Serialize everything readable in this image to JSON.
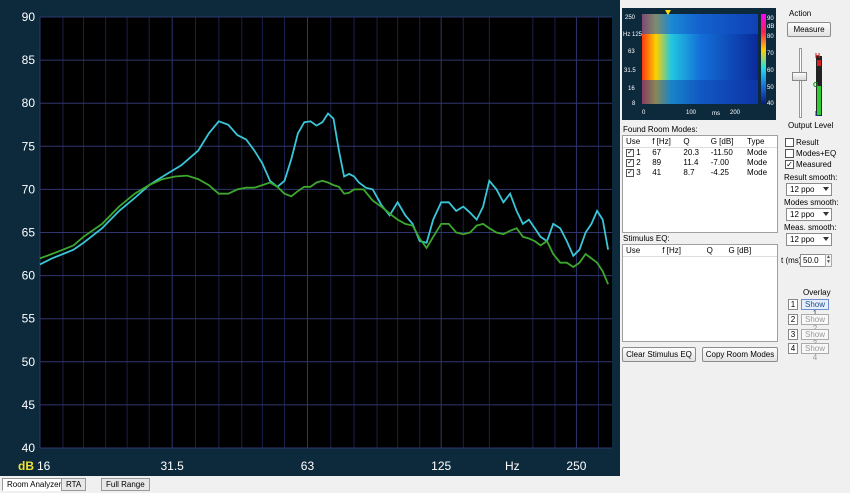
{
  "chart_data": {
    "type": "line",
    "ylabel": "dB",
    "xlabel": "Hz",
    "ylim": [
      40,
      90
    ],
    "xlim_hz": [
      16,
      300
    ],
    "x_scale": "log",
    "grid": true,
    "y_ticks": [
      90,
      85,
      80,
      75,
      70,
      65,
      60,
      55,
      50,
      45,
      40
    ],
    "x_ticks": [
      {
        "label": "16",
        "hz": 16
      },
      {
        "label": "31.5",
        "hz": 31.5
      },
      {
        "label": "63",
        "hz": 63
      },
      {
        "label": "125",
        "hz": 125
      },
      {
        "label": "Hz",
        "hz": 180
      },
      {
        "label": "250",
        "hz": 250
      }
    ],
    "series": [
      {
        "color": "#39c6d8",
        "points": [
          [
            16,
            61.3
          ],
          [
            17,
            62.0
          ],
          [
            18,
            62.5
          ],
          [
            19,
            63.0
          ],
          [
            20,
            63.8
          ],
          [
            22,
            65.5
          ],
          [
            24,
            67.5
          ],
          [
            26,
            69.0
          ],
          [
            28,
            70.5
          ],
          [
            30,
            71.5
          ],
          [
            33,
            72.8
          ],
          [
            36,
            74.5
          ],
          [
            38,
            76.5
          ],
          [
            40,
            77.9
          ],
          [
            42,
            77.5
          ],
          [
            44,
            76.3
          ],
          [
            46,
            75.8
          ],
          [
            48,
            74.5
          ],
          [
            50,
            73.0
          ],
          [
            52,
            71.0
          ],
          [
            54,
            70.3
          ],
          [
            56,
            71.0
          ],
          [
            58,
            73.5
          ],
          [
            60,
            76.5
          ],
          [
            62,
            77.8
          ],
          [
            64,
            77.9
          ],
          [
            66,
            77.4
          ],
          [
            68,
            77.8
          ],
          [
            70,
            78.8
          ],
          [
            72,
            78.2
          ],
          [
            74,
            74.5
          ],
          [
            76,
            71.5
          ],
          [
            78,
            71.8
          ],
          [
            80,
            71.5
          ],
          [
            82,
            70.8
          ],
          [
            85,
            70.2
          ],
          [
            88,
            70.0
          ],
          [
            92,
            68.2
          ],
          [
            96,
            67.0
          ],
          [
            100,
            68.5
          ],
          [
            104,
            67.0
          ],
          [
            108,
            66.0
          ],
          [
            112,
            64.0
          ],
          [
            116,
            63.8
          ],
          [
            120,
            66.5
          ],
          [
            125,
            68.5
          ],
          [
            130,
            68.5
          ],
          [
            135,
            67.5
          ],
          [
            140,
            68.0
          ],
          [
            145,
            67.3
          ],
          [
            150,
            66.5
          ],
          [
            155,
            68.0
          ],
          [
            160,
            71.0
          ],
          [
            166,
            70.0
          ],
          [
            172,
            68.5
          ],
          [
            178,
            69.5
          ],
          [
            184,
            67.5
          ],
          [
            190,
            66.0
          ],
          [
            196,
            66.5
          ],
          [
            202,
            65.5
          ],
          [
            208,
            64.5
          ],
          [
            215,
            64.0
          ],
          [
            222,
            66.0
          ],
          [
            230,
            65.5
          ],
          [
            238,
            64.0
          ],
          [
            246,
            62.3
          ],
          [
            254,
            63.0
          ],
          [
            262,
            65.0
          ],
          [
            270,
            66.0
          ],
          [
            278,
            67.5
          ],
          [
            286,
            66.5
          ],
          [
            294,
            63.0
          ]
        ]
      },
      {
        "color": "#3ca82d",
        "points": [
          [
            16,
            62.0
          ],
          [
            17,
            62.5
          ],
          [
            18,
            63.0
          ],
          [
            19,
            63.5
          ],
          [
            20,
            64.5
          ],
          [
            22,
            66.0
          ],
          [
            24,
            68.0
          ],
          [
            26,
            69.5
          ],
          [
            28,
            70.5
          ],
          [
            30,
            71.2
          ],
          [
            32,
            71.5
          ],
          [
            34,
            71.6
          ],
          [
            36,
            71.2
          ],
          [
            38,
            70.5
          ],
          [
            40,
            69.5
          ],
          [
            42,
            69.5
          ],
          [
            44,
            70.0
          ],
          [
            46,
            70.2
          ],
          [
            48,
            70.2
          ],
          [
            50,
            70.5
          ],
          [
            52,
            70.8
          ],
          [
            54,
            70.3
          ],
          [
            56,
            69.5
          ],
          [
            58,
            69.2
          ],
          [
            60,
            69.8
          ],
          [
            62,
            70.3
          ],
          [
            64,
            70.3
          ],
          [
            66,
            70.8
          ],
          [
            68,
            71.0
          ],
          [
            70,
            70.8
          ],
          [
            72,
            70.5
          ],
          [
            74,
            70.3
          ],
          [
            76,
            69.5
          ],
          [
            78,
            69.6
          ],
          [
            80,
            70.0
          ],
          [
            84,
            70.0
          ],
          [
            88,
            68.7
          ],
          [
            92,
            68.0
          ],
          [
            96,
            67.2
          ],
          [
            100,
            66.5
          ],
          [
            104,
            66.0
          ],
          [
            108,
            65.8
          ],
          [
            112,
            64.3
          ],
          [
            116,
            63.2
          ],
          [
            120,
            64.5
          ],
          [
            125,
            66.0
          ],
          [
            130,
            66.0
          ],
          [
            135,
            65.0
          ],
          [
            140,
            64.8
          ],
          [
            145,
            65.0
          ],
          [
            150,
            65.8
          ],
          [
            155,
            66.0
          ],
          [
            160,
            65.5
          ],
          [
            166,
            65.0
          ],
          [
            172,
            64.8
          ],
          [
            178,
            65.2
          ],
          [
            184,
            65.5
          ],
          [
            190,
            64.5
          ],
          [
            196,
            64.3
          ],
          [
            202,
            64.0
          ],
          [
            208,
            63.5
          ],
          [
            215,
            64.0
          ],
          [
            222,
            62.5
          ],
          [
            230,
            61.5
          ],
          [
            238,
            61.5
          ],
          [
            246,
            61.0
          ],
          [
            254,
            61.5
          ],
          [
            262,
            62.5
          ],
          [
            270,
            62.0
          ],
          [
            278,
            61.5
          ],
          [
            286,
            60.5
          ],
          [
            294,
            59.0
          ]
        ]
      }
    ]
  },
  "right_panel": {
    "waterfall": {
      "y_ticks": [
        "250",
        "Hz 125",
        "63",
        "31.5",
        "16",
        "8"
      ],
      "x_ticks": [
        "0",
        "100",
        "ms",
        "200"
      ],
      "scale_ticks": [
        "90",
        "dB",
        "80",
        "70",
        "60",
        "50",
        "40"
      ]
    },
    "action_label": "Action",
    "measure_button": "Measure",
    "output_level_label": "Output Level",
    "meter_h": "H",
    "meter_g": "G",
    "meter_l": "L",
    "found_modes_label": "Found Room Modes:",
    "modes_headers": [
      "Use",
      "f [Hz]",
      "Q",
      "G [dB]",
      "Type"
    ],
    "modes_rows": [
      {
        "use": "1",
        "f": "67",
        "q": "20.3",
        "g": "-11.50",
        "type": "Mode"
      },
      {
        "use": "2",
        "f": "89",
        "q": "11.4",
        "g": "-7.00",
        "type": "Mode"
      },
      {
        "use": "3",
        "f": "41",
        "q": "8.7",
        "g": "-4.25",
        "type": "Mode"
      }
    ],
    "stimulus_label": "Stimulus EQ:",
    "stimulus_headers": [
      "Use",
      "f [Hz]",
      "Q",
      "G [dB]"
    ],
    "check_result": "Result",
    "check_modes_eq": "Modes+EQ",
    "check_measured": "Measured",
    "result_smooth_label": "Result smooth:",
    "result_smooth_value": "12 ppo",
    "modes_smooth_label": "Modes smooth:",
    "modes_smooth_value": "12 ppo",
    "meas_smooth_label": "Meas. smooth:",
    "meas_smooth_value": "12 ppo",
    "t_label": "t (ms)",
    "t_value": "50.0",
    "overlay_label": "Overlay",
    "overlay_nums": [
      "1",
      "2",
      "3",
      "4"
    ],
    "overlay_shows": [
      "Show 1",
      "Show 2",
      "Show 3",
      "Show 4"
    ],
    "clear_button": "Clear Stimulus EQ",
    "copy_button": "Copy Room Modes"
  },
  "tabs": [
    "Room Analyzer",
    "RTA",
    "Full Range"
  ]
}
